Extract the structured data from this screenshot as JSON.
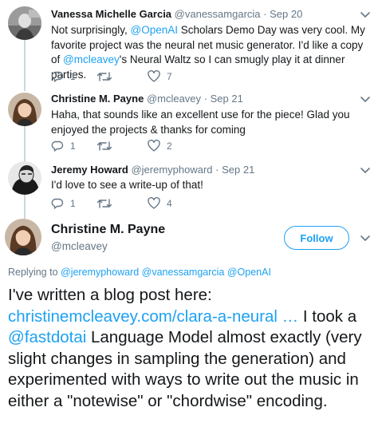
{
  "tweets": [
    {
      "name": "Vanessa Michelle Garcia",
      "handle": "@vanessamgarcia",
      "separator": "·",
      "date": "Sep 20",
      "text_parts": [
        {
          "text": "Not surprisingly, ",
          "mention": false
        },
        {
          "text": "@OpenAI",
          "mention": true
        },
        {
          "text": " Scholars Demo Day was very cool. My favorite project was the neural net music generator. I'd like a copy of ",
          "mention": false
        },
        {
          "text": "@mcleavey",
          "mention": true
        },
        {
          "text": "'s Neural Waltz so I can smugly play it at dinner parties.",
          "mention": false
        }
      ],
      "replies": "1",
      "retweets": "",
      "likes": "7"
    },
    {
      "name": "Christine M. Payne",
      "handle": "@mcleavey",
      "separator": "·",
      "date": "Sep 21",
      "text_parts": [
        {
          "text": "Haha, that sounds like an excellent use for the piece! Glad you enjoyed the projects & thanks for coming",
          "mention": false
        }
      ],
      "replies": "1",
      "retweets": "",
      "likes": "2"
    },
    {
      "name": "Jeremy Howard",
      "handle": "@jeremyphoward",
      "separator": "·",
      "date": "Sep 21",
      "text_parts": [
        {
          "text": "I'd love to see a write-up of that!",
          "mention": false
        }
      ],
      "replies": "1",
      "retweets": "",
      "likes": "4"
    }
  ],
  "main_tweet": {
    "name": "Christine M. Payne",
    "handle": "@mcleavey",
    "follow_label": "Follow",
    "replying_prefix": "Replying to ",
    "replying_to": [
      "@jeremyphoward",
      "@vanessamgarcia",
      "@OpenAI"
    ],
    "text_parts": [
      {
        "text": "I've written a blog post here: ",
        "mention": false
      },
      {
        "text": "christinemcleavey.com/clara-a-neural …",
        "mention": true
      },
      {
        "text": "  I took a ",
        "mention": false
      },
      {
        "text": "@fastdotai",
        "mention": true
      },
      {
        "text": " Language Model almost exactly (very slight changes in sampling the generation) and experimented with ways to write out the music in either a \"notewise\" or \"chordwise\" encoding.",
        "mention": false
      }
    ]
  },
  "icons": {
    "reply": "reply-icon",
    "retweet": "retweet-icon",
    "like": "heart-icon",
    "more": "chevron-down-icon"
  },
  "colors": {
    "accent": "#1da1f2",
    "secondary_text": "#657786",
    "thread_line": "#ccd6dd"
  }
}
